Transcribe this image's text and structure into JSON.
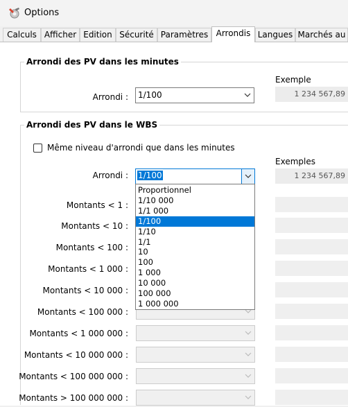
{
  "window": {
    "title": "Options"
  },
  "tabs": [
    {
      "label": "Calculs"
    },
    {
      "label": "Afficher"
    },
    {
      "label": "Edition"
    },
    {
      "label": "Sécurité"
    },
    {
      "label": "Paramètres"
    },
    {
      "label": "Arrondis",
      "active": true
    },
    {
      "label": "Langues"
    },
    {
      "label": "Marchés au"
    }
  ],
  "section_minutes": {
    "title": "Arrondi des PV dans les minutes",
    "arrondi_label": "Arrondi :",
    "arrondi_value": "1/100",
    "example_header": "Exemple",
    "example_value": "1 234 567,89"
  },
  "section_wbs": {
    "title": "Arrondi des PV dans le WBS",
    "checkbox_label": "Même niveau d'arrondi que dans les minutes",
    "checkbox_checked": false,
    "arrondi_label": "Arrondi :",
    "arrondi_value": "1/100",
    "example_header": "Exemples",
    "example_value": "1 234 567,89",
    "montants": [
      {
        "label": "Montants < 1 :"
      },
      {
        "label": "Montants < 10 :"
      },
      {
        "label": "Montants < 100 :"
      },
      {
        "label": "Montants < 1 000 :"
      },
      {
        "label": "Montants < 10 000 :"
      },
      {
        "label": "Montants < 100 000 :"
      },
      {
        "label": "Montants < 1 000 000 :"
      },
      {
        "label": "Montants < 10 000 000 :"
      },
      {
        "label": "Montants < 100 000 000 :"
      },
      {
        "label": "Montants > 100 000 000 :"
      }
    ]
  },
  "dropdown": {
    "selected": "1/100",
    "options": [
      "Proportionnel",
      "1/10 000",
      "1/1 000",
      "1/100",
      "1/10",
      "1/1",
      "10",
      "100",
      "1 000",
      "10 000",
      "100 000",
      "1 000 000"
    ]
  },
  "colors": {
    "accent": "#0078d7",
    "panel": "#ffffff",
    "window_bg": "#f0f0f0"
  },
  "icons": {
    "app": "options-wrench-icon",
    "chevron": "chevron-down-icon"
  }
}
